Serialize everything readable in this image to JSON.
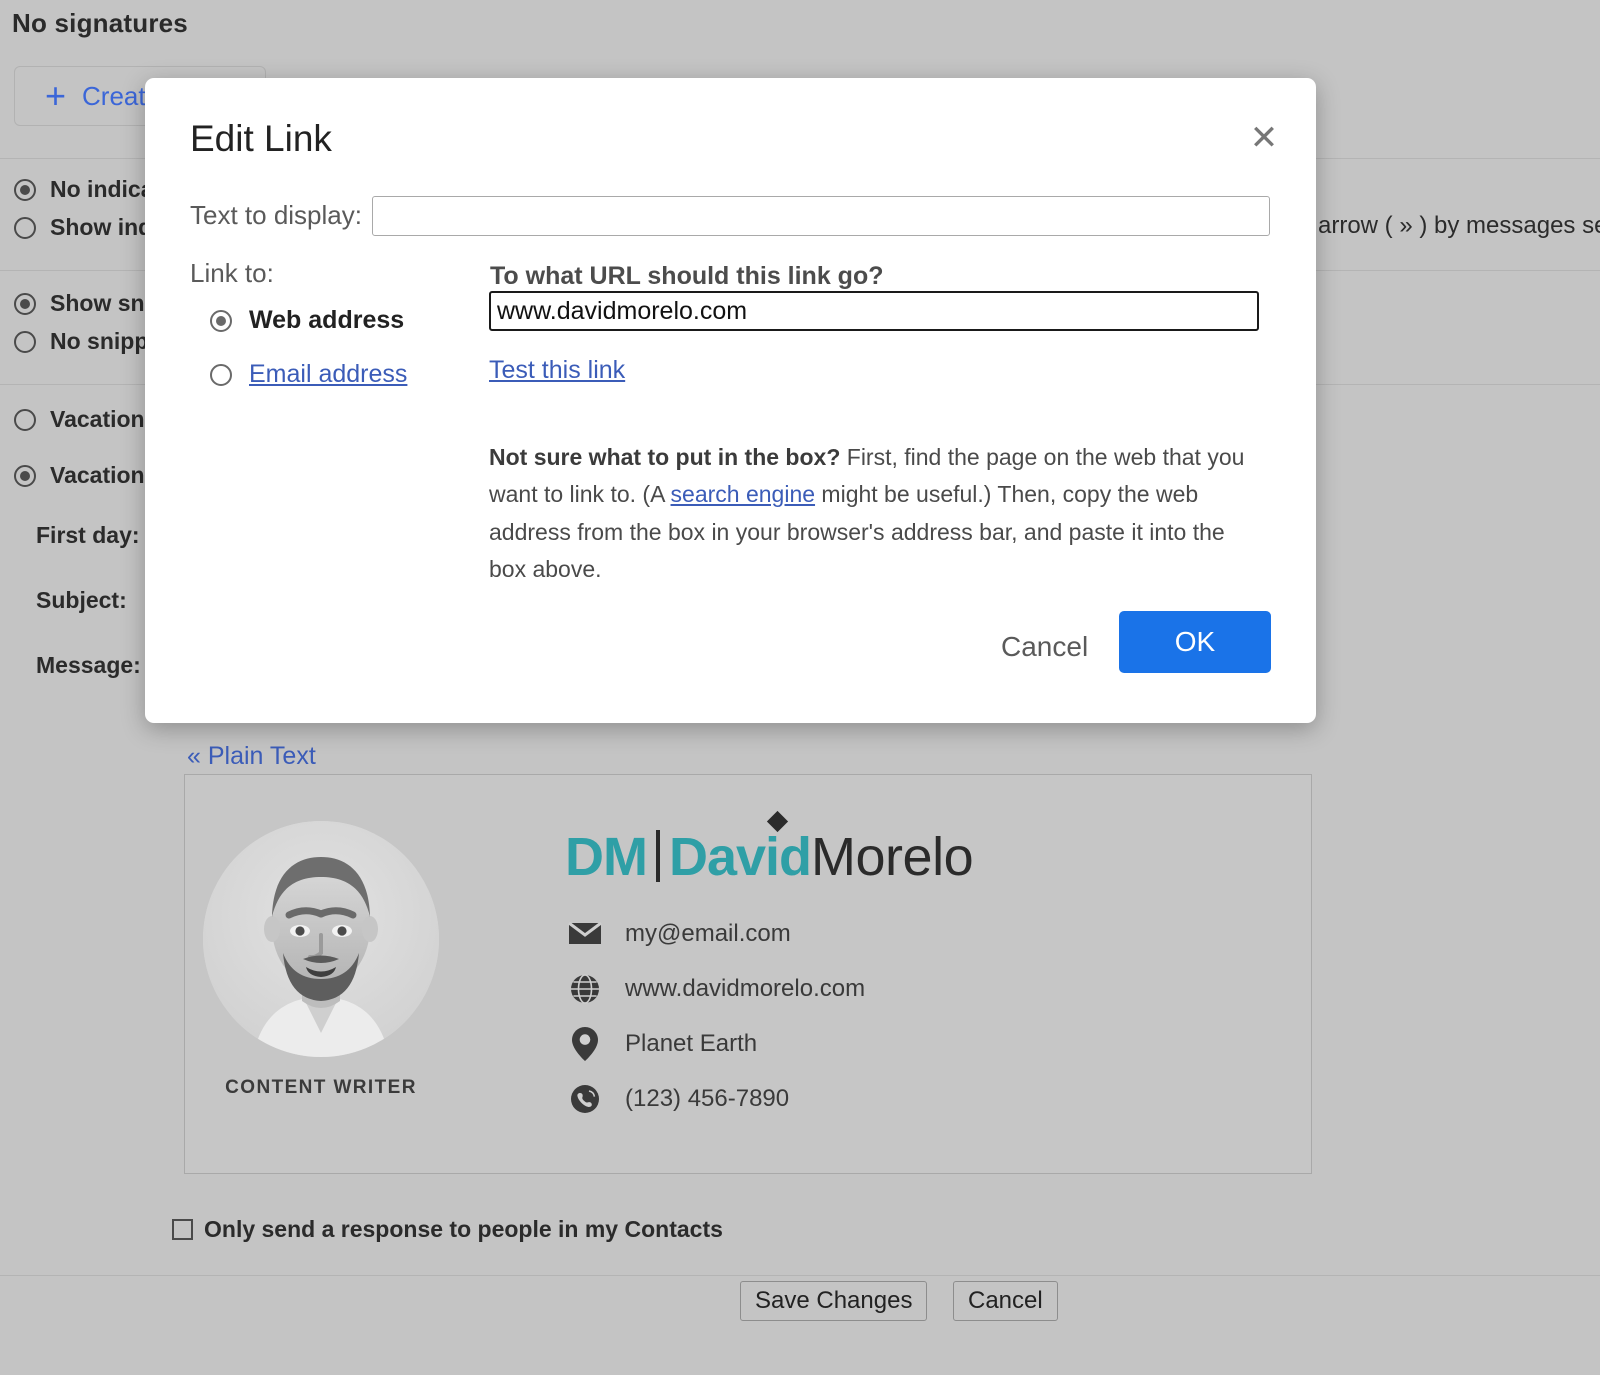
{
  "background": {
    "title": "No signatures",
    "create_button": {
      "plus": "+",
      "label": "Create new"
    },
    "radio_groups": [
      {
        "options": [
          {
            "label": "No indicators",
            "selected": true
          },
          {
            "label": "Show indicators",
            "selected": false
          }
        ]
      },
      {
        "options": [
          {
            "label": "Show snippets",
            "selected": true
          },
          {
            "label": "No snippets",
            "selected": false
          }
        ]
      },
      {
        "options": [
          {
            "label": "Vacation responder off",
            "selected": false
          }
        ]
      },
      {
        "options": [
          {
            "label": "Vacation responder on",
            "selected": true
          }
        ]
      }
    ],
    "fields": [
      {
        "label": "First day:"
      },
      {
        "label": "Subject:"
      },
      {
        "label": "Message:"
      }
    ],
    "right_clipped_text": "arrow ( » ) by messages sent to my address",
    "plain_text_link": "« Plain Text",
    "only_send_label": "Only send a response to people in my Contacts",
    "save_button": "Save Changes",
    "cancel_button": "Cancel"
  },
  "signature": {
    "role": "CONTENT WRITER",
    "logo": {
      "mark": "DM",
      "first": "David",
      "last": "Morelo"
    },
    "contacts": [
      {
        "icon": "envelope-icon",
        "text": "my@email.com"
      },
      {
        "icon": "globe-icon",
        "text": "www.davidmorelo.com"
      },
      {
        "icon": "location-pin-icon",
        "text": "Planet Earth"
      },
      {
        "icon": "phone-icon",
        "text": "(123) 456-7890"
      }
    ]
  },
  "dialog": {
    "title": "Edit Link",
    "close_icon": "✕",
    "text_to_display": {
      "label": "Text to display:",
      "value": "",
      "placeholder": ""
    },
    "link_to": {
      "label": "Link to:"
    },
    "options": [
      {
        "label": "Web address",
        "selected": true,
        "is_link": false
      },
      {
        "label": "Email address",
        "selected": false,
        "is_link": true
      }
    ],
    "url_question": "To what URL should this link go?",
    "url_value": "www.davidmorelo.com",
    "test_link": "Test this link",
    "help": {
      "lead": "Not sure what to put in the box?",
      "part1": " First, find the page on the web that you want to link to. (A ",
      "link": "search engine",
      "part2": " might be useful.) Then, copy the web address from the box in your browser's address bar, and paste it into the box above."
    },
    "cancel_label": "Cancel",
    "ok_label": "OK"
  },
  "colors": {
    "accent_blue": "#1a73e8",
    "link_blue": "#3b5cb8",
    "teal": "#2f9fa6",
    "page_bg": "#c4c4c4"
  }
}
